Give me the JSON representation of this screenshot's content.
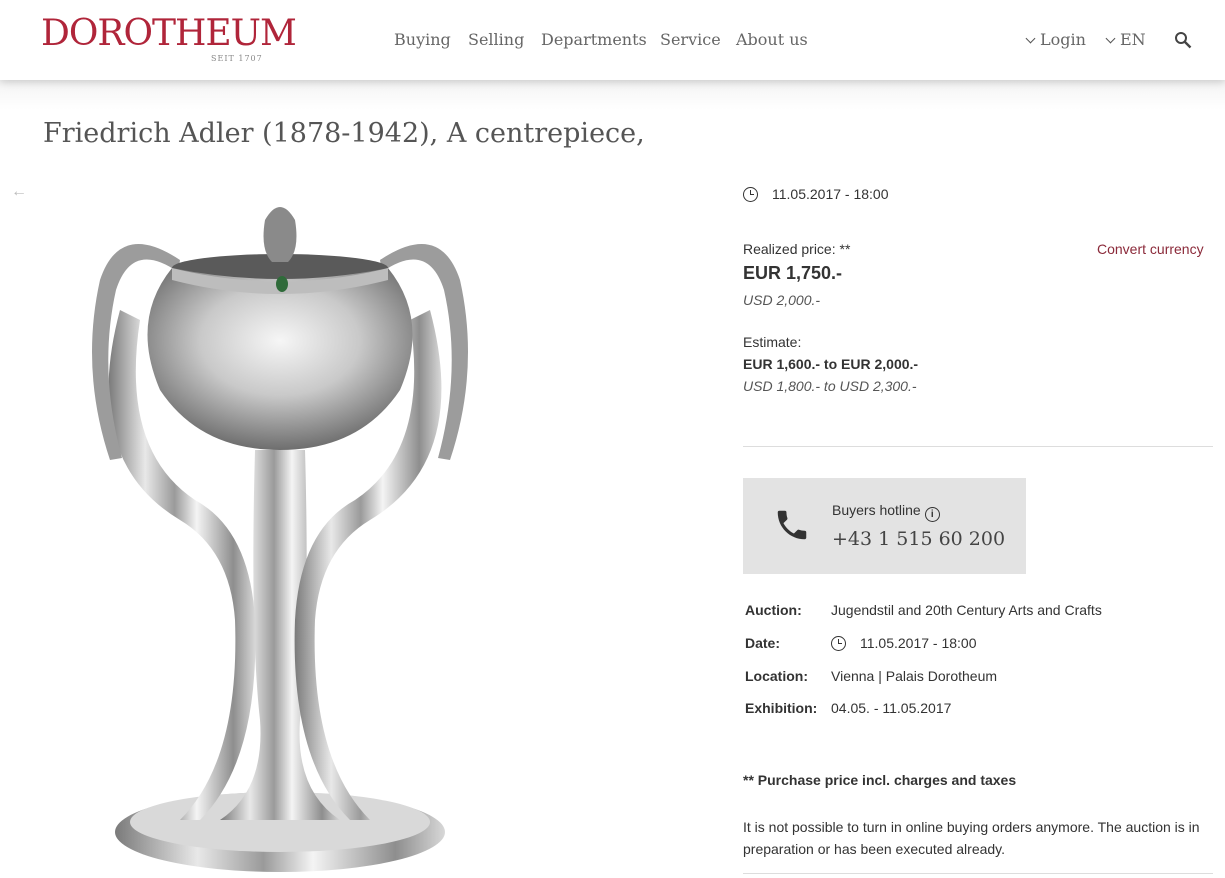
{
  "header": {
    "logo": "DOROTHEUM",
    "logo_sub": "SEIT 1707",
    "nav": [
      "Buying",
      "Selling",
      "Departments",
      "Service",
      "About us"
    ],
    "login": "Login",
    "language": "EN"
  },
  "lot": {
    "title": "Friedrich Adler (1878-1942), A centrepiece,",
    "datetime": "11.05.2017 - 18:00",
    "realized_label": "Realized price: **",
    "realized_eur": "EUR 1,750.-",
    "realized_usd": "USD 2,000.-",
    "convert_currency": "Convert currency",
    "estimate_label": "Estimate:",
    "estimate_eur": "EUR 1,600.- to EUR 2,000.-",
    "estimate_usd": "USD 1,800.- to USD 2,300.-"
  },
  "hotline": {
    "label": "Buyers hotline",
    "number": "+43 1 515 60 200"
  },
  "details": {
    "auction_label": "Auction:",
    "auction": "Jugendstil and 20th Century Arts and Crafts",
    "date_label": "Date:",
    "date": "11.05.2017 - 18:00",
    "location_label": "Location:",
    "location": "Vienna | Palais Dorotheum",
    "exhibition_label": "Exhibition:",
    "exhibition": "04.05. - 11.05.2017"
  },
  "footnote": "** Purchase price incl. charges and taxes",
  "notice": "It is not possible to turn in online buying orders anymore. The auction is in preparation or has been executed already.",
  "colors": {
    "brand": "#b0253a",
    "link": "#8b2a3a",
    "hotline_bg": "#e3e3e3"
  }
}
